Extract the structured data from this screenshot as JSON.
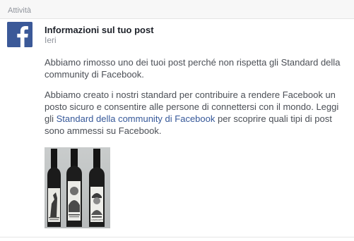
{
  "section": {
    "title": "Attività"
  },
  "notification": {
    "icon": "facebook-logo-icon",
    "brand_color": "#3b5998",
    "title": "Informazioni sul tuo post",
    "time": "Ieri",
    "paragraph1": "Abbiamo rimosso uno dei tuoi post perché non rispetta gli Standard della community di Facebook.",
    "paragraph2_before": "Abbiamo creato i nostri standard per contribuire a rendere Facebook un posto sicuro e consentire alle persone di connettersi con il mondo. Leggi gli ",
    "paragraph2_link": "Standard della community di Facebook",
    "paragraph2_after": " per scoprire quali tipi di post sono ammessi su Facebook.",
    "link_color": "#365899"
  },
  "post_image": {
    "bottles": [
      {
        "label_line1": "",
        "label_line2": ""
      },
      {
        "label_line1": "",
        "label_line2": ""
      },
      {
        "label_line1": "",
        "label_line2": "IL CAMICIOTTO"
      }
    ]
  }
}
